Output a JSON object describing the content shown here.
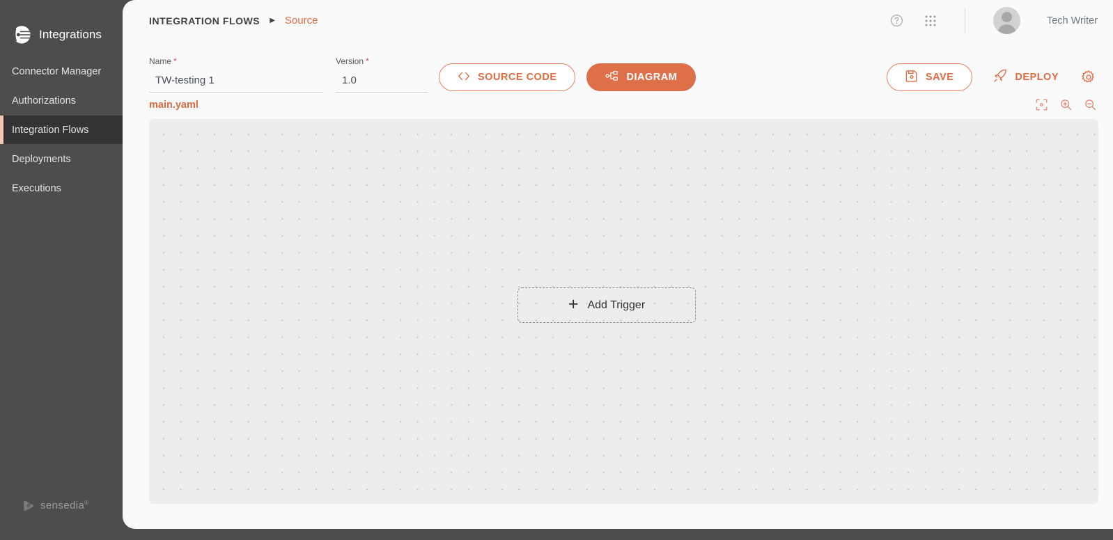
{
  "sidebar": {
    "brand": {
      "name": "Integrations",
      "logo_icon": "integrations-logo-icon"
    },
    "items": [
      {
        "label": "Connector Manager",
        "active": false
      },
      {
        "label": "Authorizations",
        "active": false
      },
      {
        "label": "Integration Flows",
        "active": true
      },
      {
        "label": "Deployments",
        "active": false
      },
      {
        "label": "Executions",
        "active": false
      }
    ],
    "footer": {
      "text": "sensedia",
      "mark": "®",
      "logo_icon": "sensedia-logo-icon"
    }
  },
  "header": {
    "breadcrumb": {
      "root": "INTEGRATION FLOWS",
      "separator": "▶",
      "current": "Source"
    },
    "help_icon": "help-circle-icon",
    "apps_icon": "apps-grid-icon",
    "user": {
      "name": "Tech Writer",
      "avatar_icon": "user-avatar-icon"
    }
  },
  "form": {
    "name": {
      "label": "Name",
      "required": "*",
      "value": "TW-testing 1",
      "placeholder": "Name"
    },
    "version": {
      "label": "Version",
      "required": "*",
      "value": "1.0",
      "placeholder": "Version"
    }
  },
  "view_toggle": {
    "source_code": {
      "label": "SOURCE CODE",
      "icon": "code-brackets-icon",
      "selected": false
    },
    "diagram": {
      "label": "DIAGRAM",
      "icon": "diagram-nodes-icon",
      "selected": true
    }
  },
  "actions": {
    "save": {
      "label": "SAVE",
      "icon": "floppy-disk-icon"
    },
    "deploy": {
      "label": "DEPLOY",
      "icon": "rocket-icon"
    },
    "settings": {
      "icon": "gear-icon"
    }
  },
  "editor": {
    "file_name": "main.yaml",
    "tools": {
      "fit": "fit-to-screen-icon",
      "zoom_in": "zoom-in-icon",
      "zoom_out": "zoom-out-icon"
    },
    "canvas": {
      "add_trigger": {
        "label": "Add Trigger",
        "plus": "+"
      }
    }
  },
  "colors": {
    "accent": "#e06a40",
    "accent_fill": "#dd7049",
    "sidebar_bg": "#4d4d4d",
    "sidebar_active_bg": "#333333",
    "sidebar_active_bar": "#f3c6b4",
    "panel_bg": "#fafafa",
    "canvas_bg": "#ededed",
    "required_mark": "#e0465e"
  }
}
